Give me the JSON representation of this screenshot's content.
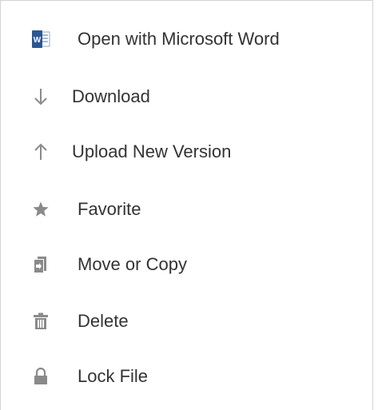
{
  "menu": {
    "items": [
      {
        "label": "Open with Microsoft Word",
        "icon": "microsoft-word-icon"
      },
      {
        "label": "Download",
        "icon": "download-arrow-icon"
      },
      {
        "label": "Upload New Version",
        "icon": "upload-arrow-icon"
      },
      {
        "label": "Favorite",
        "icon": "star-icon"
      },
      {
        "label": "Move or Copy",
        "icon": "move-copy-icon"
      },
      {
        "label": "Delete",
        "icon": "trash-icon"
      },
      {
        "label": "Lock File",
        "icon": "lock-icon"
      }
    ]
  },
  "colors": {
    "text": "#333333",
    "icon": "#8a8a8a",
    "word_blue": "#2b5797",
    "border": "#d4d4d4"
  }
}
